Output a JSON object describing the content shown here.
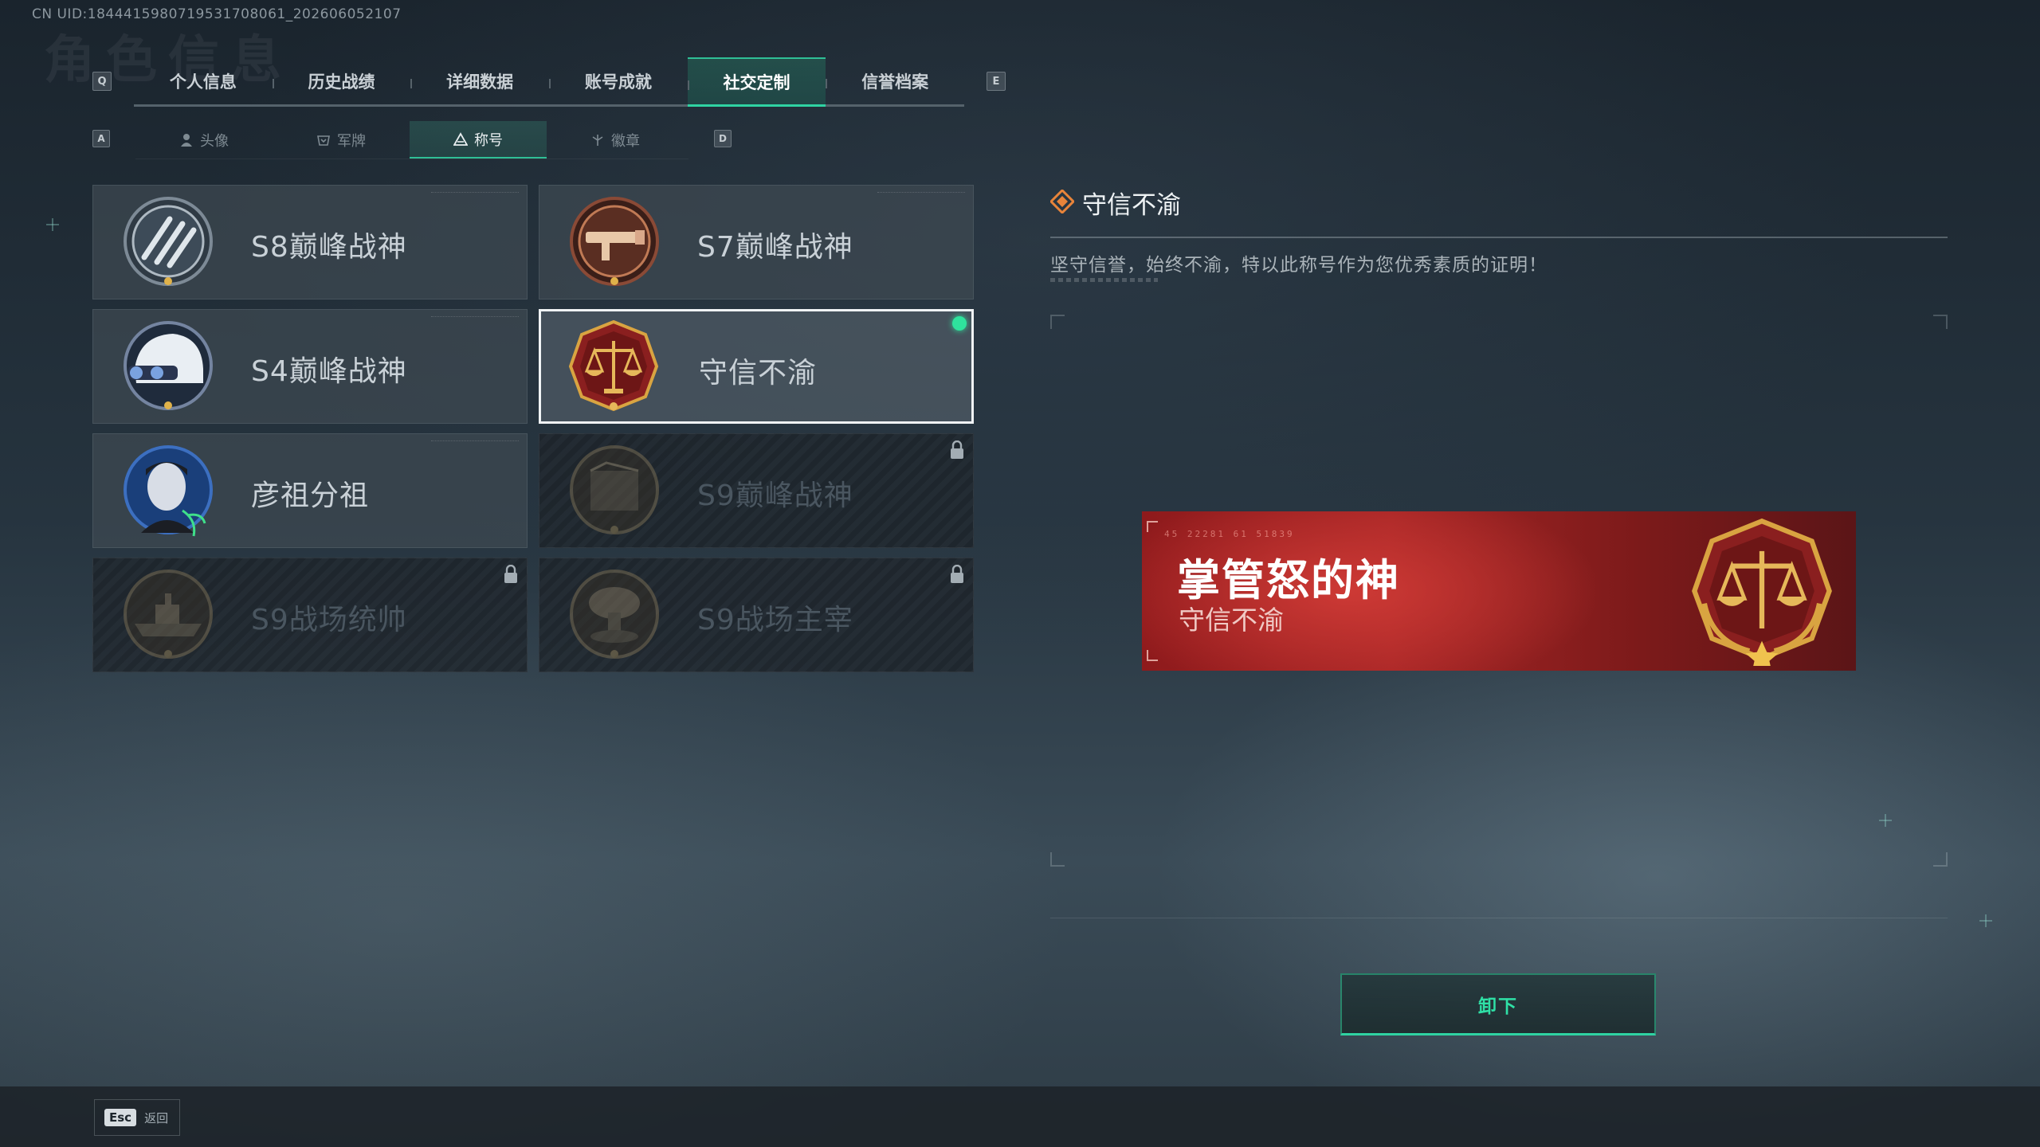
{
  "header": {
    "uid": "CN UID:1844415980719531708061_202606052107",
    "ghost_title": "角色信息"
  },
  "tabs": {
    "prev_key": "Q",
    "next_key": "E",
    "items": [
      "个人信息",
      "历史战绩",
      "详细数据",
      "账号成就",
      "社交定制",
      "信誉档案"
    ],
    "active": "社交定制"
  },
  "subtabs": {
    "prev_key": "A",
    "next_key": "D",
    "items": [
      "头像",
      "军牌",
      "称号",
      "徽章"
    ],
    "active": "称号"
  },
  "titles": [
    {
      "label": "S8巅峰战神",
      "locked": false,
      "selected": false,
      "emblem": "s8-emblem"
    },
    {
      "label": "S7巅峰战神",
      "locked": false,
      "selected": false,
      "emblem": "s7-emblem"
    },
    {
      "label": "S4巅峰战神",
      "locked": false,
      "selected": false,
      "emblem": "s4-emblem"
    },
    {
      "label": "守信不渝",
      "locked": false,
      "selected": true,
      "emblem": "scales-emblem"
    },
    {
      "label": "彦祖分祖",
      "locked": false,
      "selected": false,
      "emblem": "portrait-emblem"
    },
    {
      "label": "S9巅峰战神",
      "locked": true,
      "selected": false,
      "emblem": "s9-emblem"
    },
    {
      "label": "S9战场统帅",
      "locked": true,
      "selected": false,
      "emblem": "ship-emblem"
    },
    {
      "label": "S9战场主宰",
      "locked": true,
      "selected": false,
      "emblem": "mushroom-cloud-emblem"
    }
  ],
  "detail": {
    "title": "守信不渝",
    "description": "坚守信誉，始终不渝，特以此称号作为您优秀素质的证明！"
  },
  "banner": {
    "tag": "45 22281  61 51839",
    "player_name": "掌管怒的神",
    "title": "守信不渝"
  },
  "actions": {
    "unequip_label": "卸下"
  },
  "footer": {
    "esc_key": "Esc",
    "esc_label": "返回"
  },
  "colors": {
    "accent": "#2fd3a2",
    "equipped_dot": "#2fe39d",
    "banner_red": "#a52525",
    "gold": "#d9a441"
  }
}
